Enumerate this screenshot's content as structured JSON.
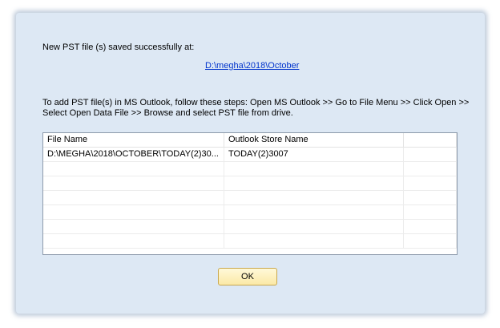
{
  "dialog": {
    "saved_message": "New PST file (s) saved successfully at:",
    "saved_path": "D:\\megha\\2018\\October",
    "instructions_line1": "To add PST file(s) in MS Outlook, follow these steps: Open MS Outlook  >> Go to File Menu >> Click Open >>",
    "instructions_line2": "Select Open Data File >>  Browse and select PST file from drive.",
    "ok_label": "OK"
  },
  "listview": {
    "columns": [
      "File Name",
      "Outlook Store Name",
      ""
    ],
    "rows": [
      [
        "D:\\MEGHA\\2018\\OCTOBER\\TODAY(2)30...",
        "TODAY(2)3007",
        ""
      ],
      [
        "",
        "",
        ""
      ],
      [
        "",
        "",
        ""
      ],
      [
        "",
        "",
        ""
      ],
      [
        "",
        "",
        ""
      ],
      [
        "",
        "",
        ""
      ],
      [
        "",
        "",
        ""
      ]
    ]
  }
}
